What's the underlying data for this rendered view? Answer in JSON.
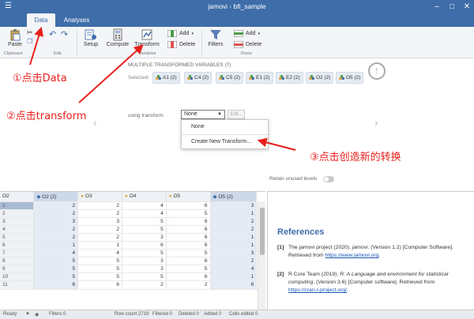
{
  "window": {
    "title": "jamovi - bfi_sample"
  },
  "tabs": [
    {
      "label": "Data"
    },
    {
      "label": "Analyses"
    }
  ],
  "ribbon": {
    "paste_label": "Paste",
    "clipboard_group": "Clipboard",
    "edit_group": "Edit",
    "setup_label": "Setup",
    "compute_label": "Compute",
    "transform_label": "Transform",
    "variables_group": "Variables",
    "add_label": "Add",
    "delete_label": "Delete",
    "filters_label": "Filters",
    "add2_label": "Add",
    "delete2_label": "Delete",
    "rows_group": "Rows"
  },
  "transform_panel": {
    "title": "MULTIPLE TRANSFORMED VARIABLES (7)",
    "selected_label": "Selected:",
    "chips": [
      "A1 (2)",
      "C4 (2)",
      "C5 (2)",
      "E1 (2)",
      "E2 (2)",
      "O2 (2)",
      "O5 (2)"
    ],
    "using_label": "using transform",
    "select_value": "None",
    "edit_label": "Edit...",
    "dropdown_options": [
      "None",
      "Create New Transform..."
    ],
    "retain_label": "Retain unused levels"
  },
  "annotations": {
    "step1": "①点击Data",
    "step2": "②点击transform",
    "step3": "③点击创造新的转换"
  },
  "sheet": {
    "columns": [
      "O2",
      "O2 (2)",
      "O3",
      "O4",
      "O5",
      "O5 (2)"
    ],
    "rows": [
      [
        "1",
        "2",
        "2",
        "4",
        "6",
        "3",
        "3"
      ],
      [
        "2",
        "2",
        "2",
        "4",
        "5",
        "1",
        "1"
      ],
      [
        "3",
        "3",
        "3",
        "5",
        "6",
        "2",
        "2"
      ],
      [
        "4",
        "2",
        "2",
        "5",
        "6",
        "2",
        "2"
      ],
      [
        "5",
        "2",
        "2",
        "3",
        "6",
        "1",
        "1"
      ],
      [
        "6",
        "1",
        "1",
        "6",
        "6",
        "1",
        "1"
      ],
      [
        "7",
        "4",
        "4",
        "5",
        "5",
        "3",
        "3"
      ],
      [
        "8",
        "5",
        "5",
        "3",
        "6",
        "2",
        "2"
      ],
      [
        "9",
        "5",
        "5",
        "3",
        "5",
        "4",
        "4"
      ],
      [
        "10",
        "5",
        "5",
        "5",
        "6",
        "1",
        "1"
      ],
      [
        "11",
        "6",
        "6",
        "2",
        "2",
        "6",
        "6"
      ]
    ]
  },
  "results": {
    "title": "References",
    "refs": [
      {
        "n": "[1]",
        "pre": "The jamovi project (2020). ",
        "em": "jamovi",
        "post": ". (Version 1.2) [Computer Software]. Retrieved from ",
        "link": "https://www.jamovi.org",
        "end": "."
      },
      {
        "n": "[2]",
        "pre": "R Core Team (2019). ",
        "em": "R: A Language and environment for statistical computing",
        "post": ". (Version 3.6) [Computer software]. Retrieved from ",
        "link": "https://cran.r-project.org/",
        "end": "."
      }
    ]
  },
  "status": {
    "ready": "Ready",
    "filters": "Filters 0",
    "row_count": "Row count 2719",
    "filtered": "Filtered 0",
    "deleted": "Deleted 0",
    "added": "Added 0",
    "cells_edited": "Cells edited 0"
  },
  "colors": {
    "accent": "#3e6da9",
    "annotation": "#e8201b"
  }
}
